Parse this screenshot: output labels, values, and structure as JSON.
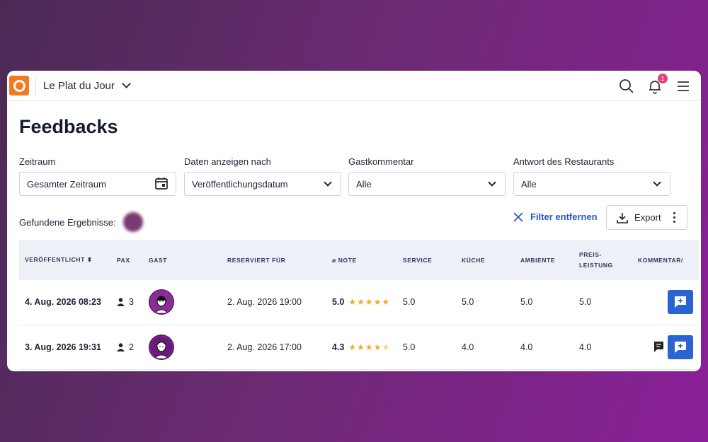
{
  "header": {
    "restaurant_name": "Le Plat du Jour",
    "notification_count": "1"
  },
  "page": {
    "title": "Feedbacks"
  },
  "filters": [
    {
      "label": "Zeitraum",
      "value": "Gesamter Zeitraum",
      "icon": "calendar-icon"
    },
    {
      "label": "Daten anzeigen nach",
      "value": "Veröffentlichungsdatum",
      "icon": "chevron-down-icon"
    },
    {
      "label": "Gastkommentar",
      "value": "Alle",
      "icon": "chevron-down-icon"
    },
    {
      "label": "Antwort des Restaurants",
      "value": "Alle",
      "icon": "chevron-down-icon"
    }
  ],
  "results": {
    "label": "Gefundene Ergebnisse:"
  },
  "actions": {
    "remove_filter": "Filter entfernen",
    "export": "Export"
  },
  "table": {
    "columns": [
      "VERÖFFENTLICHT",
      "PAX",
      "GAST",
      "RESERVIERT FÜR",
      "ø NOTE",
      "SERVICE",
      "KÜCHE",
      "AMBIENTE",
      "PREIS-\nLEISTUNG",
      "KOMMENTAR/"
    ],
    "rows": [
      {
        "published": "4. Aug. 2026 08:23",
        "pax": "3",
        "reserved": "2. Aug. 2026 19:00",
        "note": "5.0",
        "stars": 5,
        "service": "5.0",
        "kitchen": "5.0",
        "ambience": "5.0",
        "price": "5.0",
        "has_comment": false
      },
      {
        "published": "3. Aug. 2026 19:31",
        "pax": "2",
        "reserved": "2. Aug. 2026 17:00",
        "note": "4.3",
        "stars": 4.5,
        "service": "5.0",
        "kitchen": "4.0",
        "ambience": "4.0",
        "price": "4.0",
        "has_comment": true
      }
    ]
  },
  "colors": {
    "accent": "#2a63d2",
    "brand": "#f47a20",
    "star": "#f3a82b",
    "badge": "#e83e73"
  }
}
